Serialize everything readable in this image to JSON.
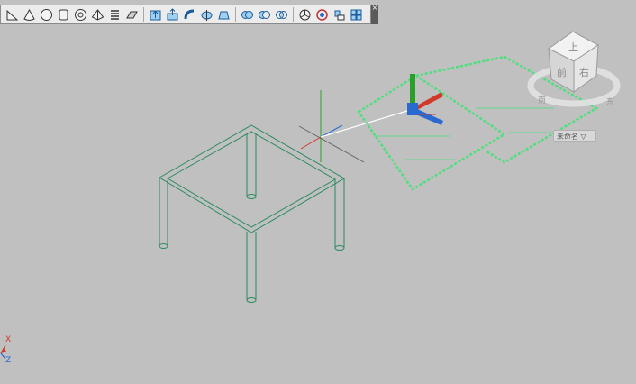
{
  "toolbar": {
    "icons": [
      "wedge-icon",
      "cone-icon",
      "sphere-icon",
      "cylinder-icon",
      "torus-icon",
      "pyramid-icon",
      "helix-icon",
      "planar-surface-icon",
      "extrude-icon",
      "presspull-icon",
      "sweep-icon",
      "revolve-icon",
      "loft-icon",
      "union-icon",
      "subtract-icon",
      "intersect-icon",
      "3d-move-icon",
      "3d-rotate-icon",
      "3d-align-icon",
      "3d-array-icon"
    ],
    "close_label": "×"
  },
  "viewcube": {
    "face_labels": [
      "上",
      "前",
      "右"
    ],
    "compass_labels": [
      "东",
      "南"
    ],
    "wcs_menu_label": "未命名 ▽"
  },
  "ucs_icon": {
    "x_label": "X",
    "z_label": "Z"
  },
  "colors": {
    "background": "#c0c0c0",
    "model_edge": "#2a8a5e",
    "selected_edge": "#4ce07c",
    "x_axis": "#d03a2a",
    "y_axis": "#2aa02a",
    "z_axis": "#2a6ad0"
  }
}
